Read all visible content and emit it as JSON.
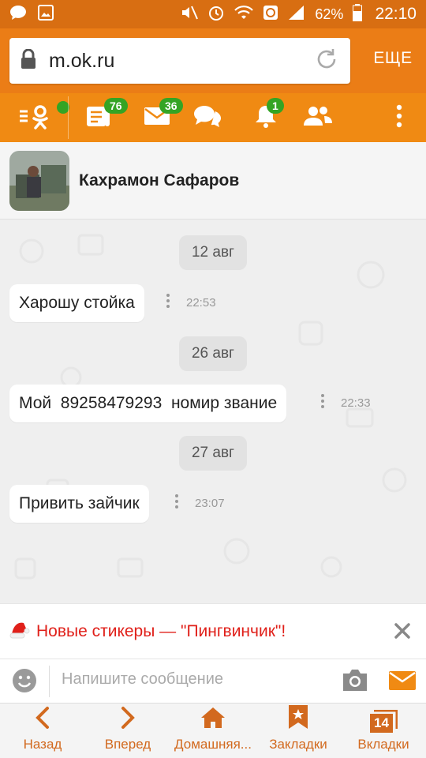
{
  "status_bar": {
    "battery": "62%",
    "time": "22:10",
    "icons": [
      "chat-icon",
      "image-icon",
      "mute-icon",
      "alarm-icon",
      "wifi-icon",
      "sync-icon",
      "signal-icon",
      "battery-icon"
    ]
  },
  "browser": {
    "url": "m.ok.ru",
    "more_label": "ЕЩЕ"
  },
  "ok_toolbar": {
    "badges": {
      "feed": "76",
      "messages": "36",
      "notifications": "1"
    }
  },
  "chat": {
    "contact_name": "Кахрамон Сафаров",
    "entries": [
      {
        "date": "12 авг",
        "text": "Харошу стойка",
        "time": "22:53"
      },
      {
        "date": "26 авг",
        "text": "Мой  89258479293  номир звание",
        "time": "22:33"
      },
      {
        "date": "27 авг",
        "text": "Привить зайчик",
        "time": "23:07"
      }
    ]
  },
  "banner": {
    "text": "Новые стикеры — \"Пингвинчик\"!"
  },
  "composer": {
    "placeholder": "Напишите сообщение"
  },
  "bottom_nav": {
    "back": "Назад",
    "forward": "Вперед",
    "home": "Домашняя...",
    "bookmarks": "Закладки",
    "tabs": "Вкладки",
    "tabs_count": "14"
  },
  "colors": {
    "accent": "#f08a13",
    "status_bar": "#d86e12",
    "badge": "#34a424",
    "banner_text": "#e0201a",
    "nav_text": "#d2691e"
  }
}
